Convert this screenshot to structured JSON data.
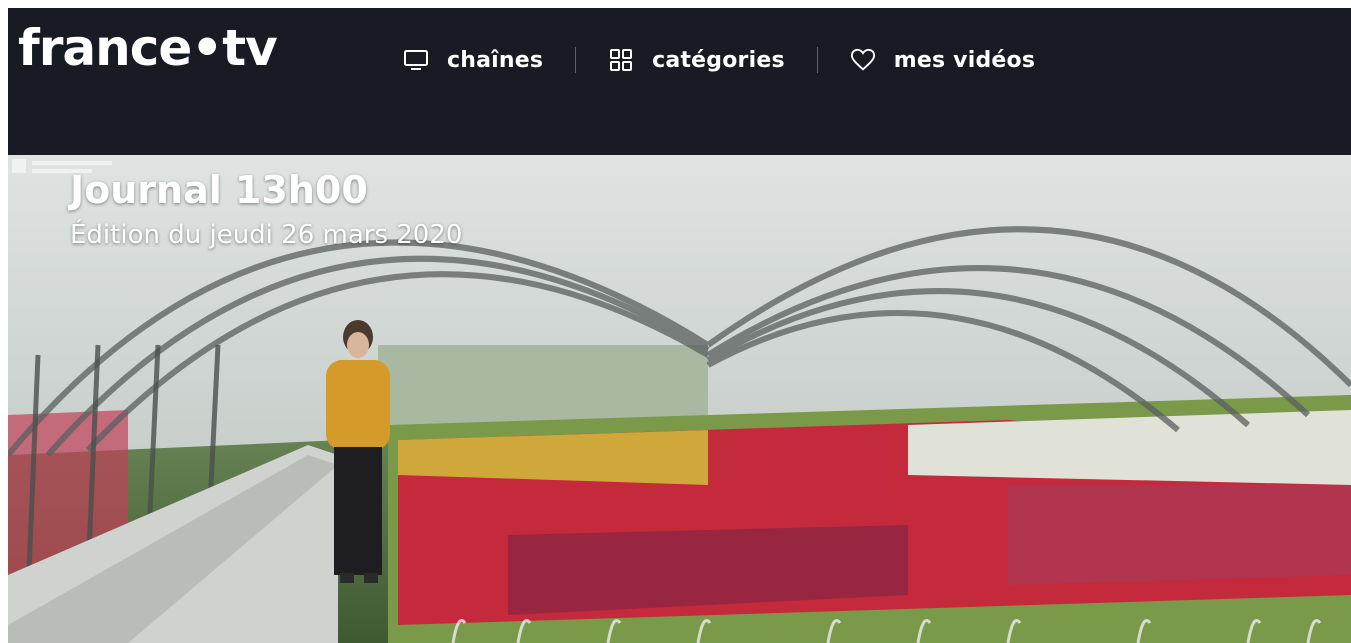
{
  "header": {
    "logo": "france•tv",
    "nav": [
      {
        "label": "chaînes",
        "icon": "tv-icon"
      },
      {
        "label": "catégories",
        "icon": "grid-icon"
      },
      {
        "label": "mes vidéos",
        "icon": "heart-icon"
      }
    ],
    "background": "#181b24"
  },
  "hero": {
    "title": "Journal 13h00",
    "subtitle": "Édition du jeudi 26 mars 2020"
  }
}
